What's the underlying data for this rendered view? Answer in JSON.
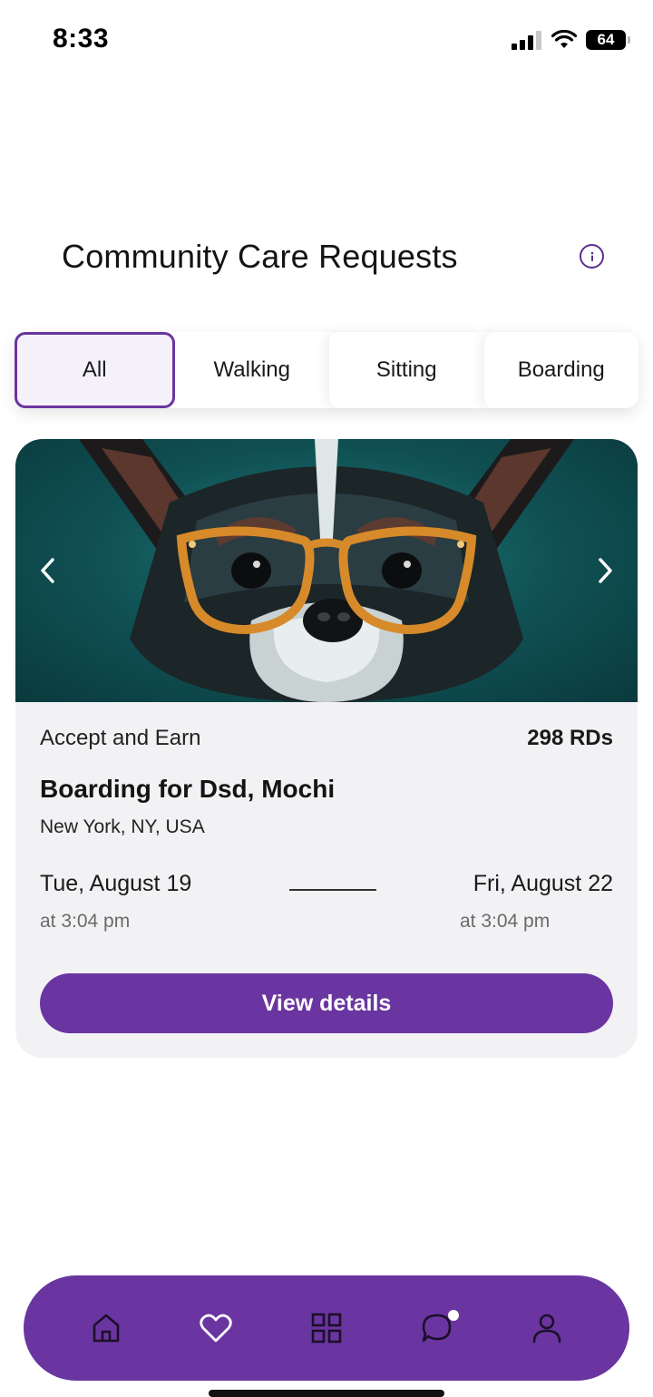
{
  "status_bar": {
    "time": "8:33",
    "battery": "64",
    "icons": [
      "signal-icon",
      "wifi-icon",
      "battery-icon"
    ]
  },
  "header": {
    "title": "Community Care Requests",
    "info_icon": "info-icon"
  },
  "tabs": [
    {
      "label": "All",
      "active": true
    },
    {
      "label": "Walking",
      "active": false
    },
    {
      "label": "Sitting",
      "active": false
    },
    {
      "label": "Boarding",
      "active": false
    }
  ],
  "request_card": {
    "image": "dog-with-glasses",
    "earn_label": "Accept and Earn",
    "earn_amount": "298 RDs",
    "title": "Boarding for Dsd, Mochi",
    "location": "New York, NY, USA",
    "start_date": "Tue, August 19",
    "start_time": "at 3:04 pm",
    "end_date": "Fri, August 22",
    "end_time": "at 3:04 pm",
    "button_label": "View details"
  },
  "bottom_nav": {
    "items": [
      "home-icon",
      "heart-icon",
      "grid-icon",
      "chat-icon",
      "profile-icon"
    ],
    "chat_has_notification": true
  },
  "colors": {
    "accent": "#6a35a0",
    "tab_active_bg": "#f5f1fa",
    "card_bg": "#f2f2f5",
    "image_bg": "#0f4f52"
  }
}
